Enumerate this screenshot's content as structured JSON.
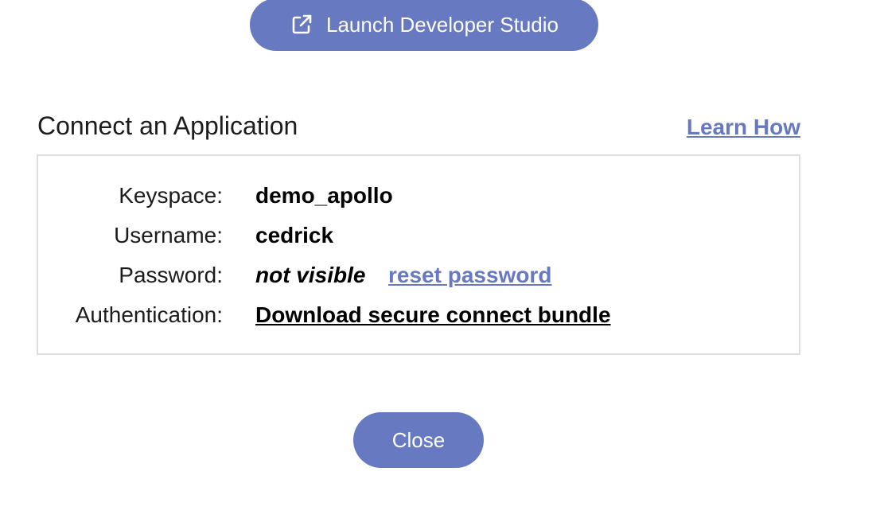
{
  "launch_button": {
    "label": "Launch Developer Studio",
    "icon": "external-link-icon"
  },
  "connect_section": {
    "title": "Connect an Application",
    "learn_how_link": "Learn How"
  },
  "credentials": {
    "keyspace": {
      "label": "Keyspace:",
      "value": "demo_apollo"
    },
    "username": {
      "label": "Username:",
      "value": "cedrick"
    },
    "password": {
      "label": "Password:",
      "value": "not visible",
      "reset_link": "reset password"
    },
    "authentication": {
      "label": "Authentication:",
      "link": "Download secure connect bundle"
    }
  },
  "close_button": {
    "label": "Close"
  },
  "colors": {
    "accent": "#6779c0",
    "border": "#dedede",
    "text": "#1c1c1c"
  }
}
